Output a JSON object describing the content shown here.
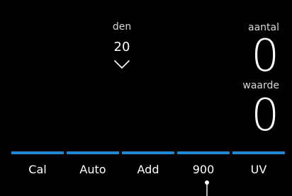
{
  "denomination": {
    "label": "den",
    "value": "20"
  },
  "count": {
    "label": "aantal",
    "value": "0"
  },
  "total": {
    "label": "waarde",
    "value": "0"
  },
  "function_keys": [
    {
      "label": "Cal"
    },
    {
      "label": "Auto"
    },
    {
      "label": "Add"
    },
    {
      "label": "900"
    },
    {
      "label": "UV"
    }
  ],
  "colors": {
    "background": "#000000",
    "accent": "#1f86d4",
    "text": "#ffffff"
  }
}
